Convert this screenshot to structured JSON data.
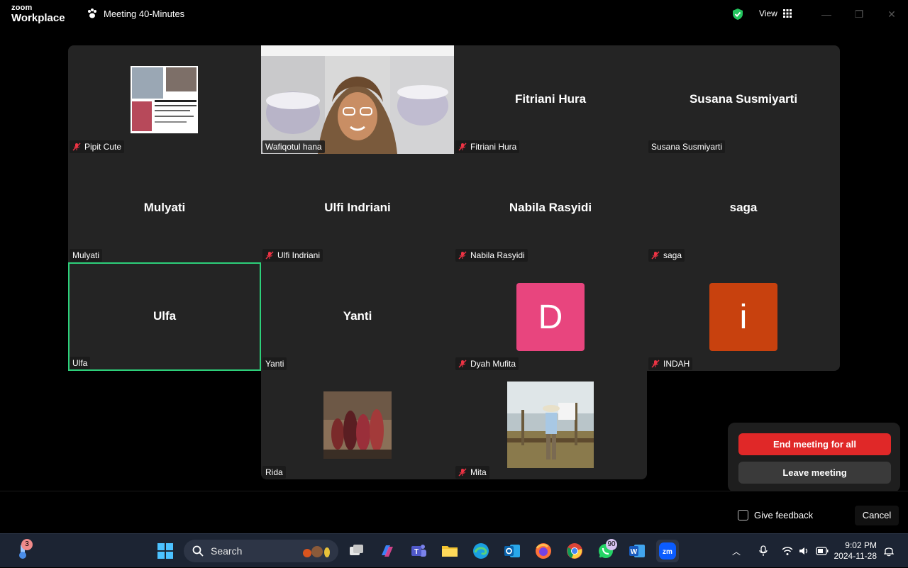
{
  "app": {
    "brand_top": "zoom",
    "brand_bottom": "Workplace",
    "meeting_title": "Meeting 40-Minutes",
    "view_label": "View"
  },
  "participants": [
    {
      "name": "Pipit Cute",
      "display": "",
      "type": "image",
      "muted": true
    },
    {
      "name": "Wafiqotul hana",
      "display": "",
      "type": "video",
      "muted": false
    },
    {
      "name": "Fitriani Hura",
      "display": "Fitriani Hura",
      "type": "name",
      "muted": true
    },
    {
      "name": "Susana Susmiyarti",
      "display": "Susana Susmiyarti",
      "type": "name",
      "muted": false
    },
    {
      "name": "Mulyati",
      "display": "Mulyati",
      "type": "name",
      "muted": false
    },
    {
      "name": "Ulfi Indriani",
      "display": "Ulfi Indriani",
      "type": "name",
      "muted": true
    },
    {
      "name": "Nabila Rasyidi",
      "display": "Nabila Rasyidi",
      "type": "name",
      "muted": true
    },
    {
      "name": "saga",
      "display": "saga",
      "type": "name",
      "muted": true
    },
    {
      "name": "Ulfa",
      "display": "Ulfa",
      "type": "name",
      "muted": false,
      "active": true
    },
    {
      "name": "Yanti",
      "display": "Yanti",
      "type": "name",
      "muted": false
    },
    {
      "name": "Dyah Mufita",
      "display": "",
      "type": "avatar",
      "letter": "D",
      "color": "#e8457e",
      "muted": true
    },
    {
      "name": "INDAH",
      "display": "",
      "type": "avatar",
      "letter": "i",
      "color": "#c8410e",
      "muted": true
    },
    {
      "name": "Rida",
      "display": "",
      "type": "image",
      "muted": false
    },
    {
      "name": "Mita",
      "display": "",
      "type": "image",
      "muted": true
    }
  ],
  "end_popup": {
    "end_all": "End meeting for all",
    "leave": "Leave meeting"
  },
  "bottom": {
    "feedback": "Give feedback",
    "cancel": "Cancel"
  },
  "taskbar": {
    "search_placeholder": "Search",
    "weather_badge": "3",
    "whatsapp_badge": "90",
    "time": "9:02 PM",
    "date": "2024-11-28"
  }
}
